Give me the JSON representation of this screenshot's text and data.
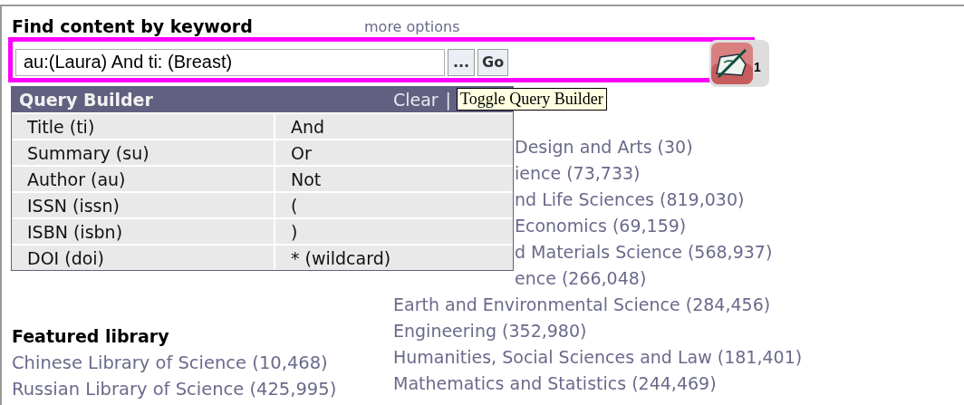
{
  "search": {
    "heading": "Find content by keyword",
    "more_options": "more options",
    "value": "au:(Laura) And ti: (Breast)",
    "browse_button": "...",
    "go_button": "Go",
    "badge": "1"
  },
  "query_builder": {
    "title": "Query Builder",
    "clear": "Clear",
    "separator": "|",
    "tooltip": "Toggle Query Builder",
    "rows": [
      {
        "field": "Title (ti)",
        "operator": "And"
      },
      {
        "field": "Summary (su)",
        "operator": "Or"
      },
      {
        "field": "Author (au)",
        "operator": "Not"
      },
      {
        "field": "ISSN (issn)",
        "operator": "("
      },
      {
        "field": "ISBN (isbn)",
        "operator": ")"
      },
      {
        "field": "DOI (doi)",
        "operator": "* (wildcard)"
      }
    ]
  },
  "subjects_partly_covered": [
    "Design and Arts (30)",
    "ience (73,733)",
    "nd Life Sciences (819,030)",
    "Economics (69,159)",
    "d Materials Science (568,937)",
    "ence (266,048)"
  ],
  "subjects": [
    "Earth and Environmental Science (284,456)",
    "Engineering (352,980)",
    "Humanities, Social Sciences and Law (181,401)",
    "Mathematics and Statistics (244,469)"
  ],
  "featured_library": {
    "heading": "Featured library",
    "links": [
      "Chinese Library of Science (10,468)",
      "Russian Library of Science (425,995)"
    ]
  }
}
